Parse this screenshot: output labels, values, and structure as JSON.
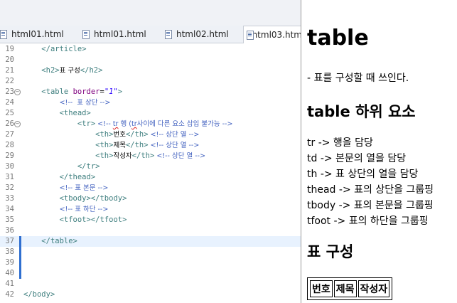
{
  "tabs": [
    {
      "label": "html01.html",
      "active": false
    },
    {
      "label": "html01.html",
      "active": false
    },
    {
      "label": "html02.html",
      "active": false
    },
    {
      "label": "html03.htm",
      "active": true
    }
  ],
  "lines": [
    {
      "n": "19",
      "fold": false
    },
    {
      "n": "20",
      "fold": false
    },
    {
      "n": "21",
      "fold": false
    },
    {
      "n": "22",
      "fold": false
    },
    {
      "n": "23",
      "fold": true
    },
    {
      "n": "24",
      "fold": false
    },
    {
      "n": "25",
      "fold": false
    },
    {
      "n": "26",
      "fold": true
    },
    {
      "n": "27",
      "fold": false
    },
    {
      "n": "28",
      "fold": false
    },
    {
      "n": "29",
      "fold": false
    },
    {
      "n": "30",
      "fold": false
    },
    {
      "n": "31",
      "fold": false
    },
    {
      "n": "32",
      "fold": false
    },
    {
      "n": "33",
      "fold": false
    },
    {
      "n": "34",
      "fold": false
    },
    {
      "n": "35",
      "fold": false
    },
    {
      "n": "36",
      "fold": false
    },
    {
      "n": "37",
      "fold": false
    },
    {
      "n": "38",
      "fold": false
    },
    {
      "n": "39",
      "fold": false
    },
    {
      "n": "40",
      "fold": false
    },
    {
      "n": "41",
      "fold": false
    },
    {
      "n": "42",
      "fold": false
    }
  ],
  "code": {
    "l19": "</article>",
    "l21a": "<h2>",
    "l21b": "표 구성",
    "l21c": "</h2>",
    "l23a": "<table ",
    "l23b": "border",
    "l23c": "=",
    "l23d": "\"1\"",
    "l23e": ">",
    "l24": "<!--  표 상단 -->",
    "l25": "<thead>",
    "l26a": "<tr>",
    "l26b": " <!-- ",
    "l26c": "tr",
    "l26d": " 행 (",
    "l26e": "tr",
    "l26f": "사이에 다른 요소 삽입 불가능 -->",
    "l27a": "<th>",
    "l27b": "번호",
    "l27c": "</th>",
    "l27d": " <!-- 상단 열 -->",
    "l28a": "<th>",
    "l28b": "제목",
    "l28c": "</th>",
    "l28d": " <!-- 상단 열 -->",
    "l29a": "<th>",
    "l29b": "작성자",
    "l29c": "</th>",
    "l29d": " <!-- 상단 열 -->",
    "l30": "</tr>",
    "l31": "</thead>",
    "l32": "<!-- 표 본문 -->",
    "l33a": "<tbody>",
    "l33b": "</tbody>",
    "l34": "<!-- 표 하단 -->",
    "l35a": "<tfoot>",
    "l35b": "</tfoot>",
    "l37": "</table>",
    "l42": "</body>"
  },
  "preview": {
    "h1": "table",
    "p1": "- 표를 구성할 때 쓰인다.",
    "h2a": "table 하위 요소",
    "items": [
      "tr -> 행을 담당",
      "td -> 본문의 열을 담당",
      "th -> 표 상단의 열을 담당",
      "thead -> 표의 상단을 그룹핑",
      "tbody -> 표의 본문을 그룹핑",
      "tfoot -> 표의 하단을 그룹핑"
    ],
    "h2b": "표 구성",
    "table_headers": [
      "번호",
      "제목",
      "작성자"
    ]
  },
  "colors": {
    "tag": "#3f7f7f",
    "attribute": "#7f007f",
    "string": "#2a00ff",
    "comment": "#3f5fbf",
    "current_line": "#e8f2fe"
  }
}
